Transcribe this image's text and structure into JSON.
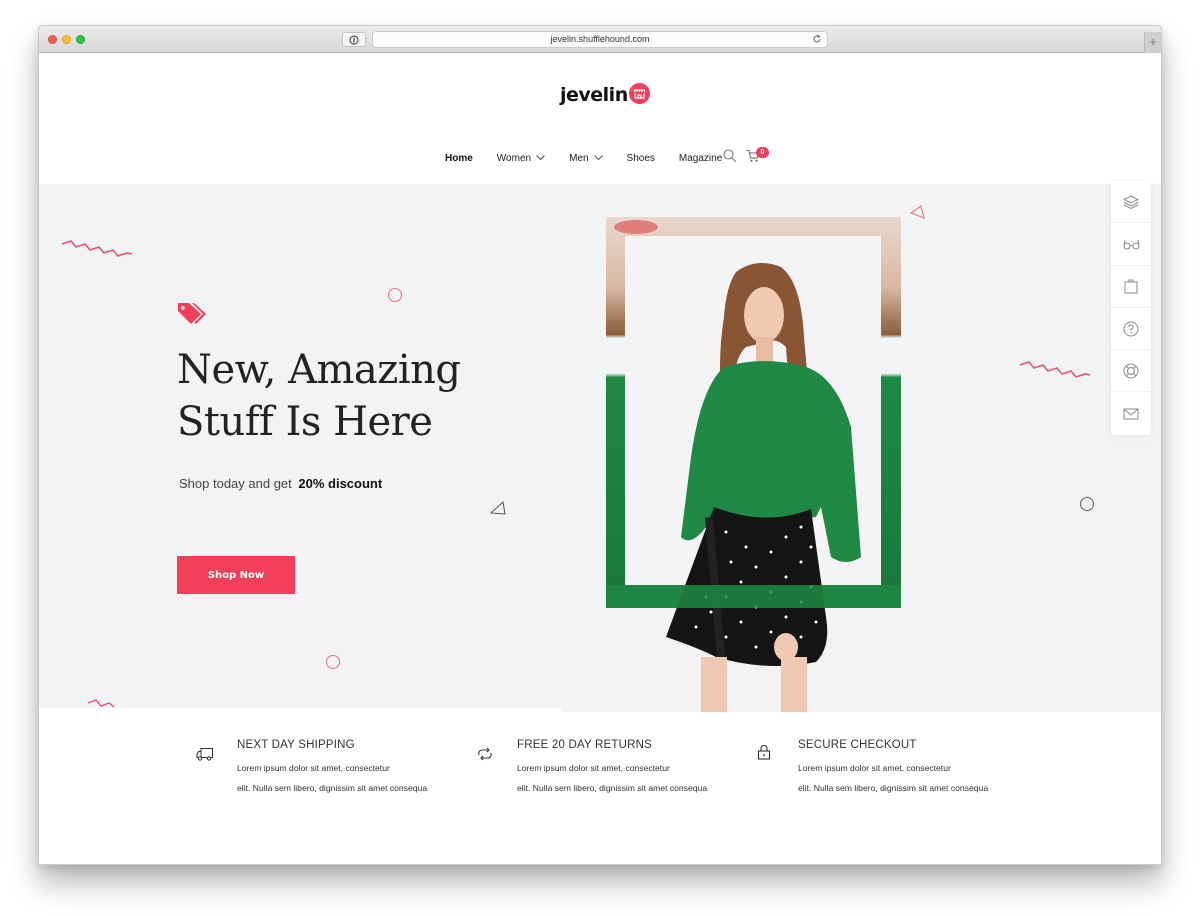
{
  "browser": {
    "url": "jevelin.shufflehound.com",
    "new_tab_label": "+"
  },
  "header": {
    "logo_text": "jevelin",
    "nav": [
      {
        "label": "Home",
        "active": true,
        "has_dropdown": false
      },
      {
        "label": "Women",
        "active": false,
        "has_dropdown": true
      },
      {
        "label": "Men",
        "active": false,
        "has_dropdown": true
      },
      {
        "label": "Shoes",
        "active": false,
        "has_dropdown": false
      },
      {
        "label": "Magazine",
        "active": false,
        "has_dropdown": false
      }
    ],
    "cart_count": "0",
    "icons": [
      "search-icon",
      "cart-icon"
    ]
  },
  "hero": {
    "title_line1": "New, Amazing",
    "title_line2": "Stuff Is Here",
    "subtitle_prefix": "Shop today and get",
    "subtitle_highlight": "20% discount",
    "cta_label": "Shop Now",
    "icon": "price-tag-icon"
  },
  "tool_rail": [
    "layers-icon",
    "glasses-icon",
    "shopping-bag-icon",
    "help-icon",
    "lifebuoy-icon",
    "mail-icon"
  ],
  "features": [
    {
      "icon": "truck-icon",
      "title": "NEXT DAY SHIPPING",
      "line1": "Lorem ipsum dolor sit amet, consectetur",
      "line2": "elit. Nulla sem libero, dignissim sit amet consequa"
    },
    {
      "icon": "refresh-icon",
      "title": "FREE 20 DAY RETURNS",
      "line1": "Lorem ipsum dolor sit amet, consectetur",
      "line2": "elit. Nulla sem libero, dignissim sit amet consequa"
    },
    {
      "icon": "lock-icon",
      "title": "SECURE CHECKOUT",
      "line1": "Lorem ipsum dolor sit amet, consectetur",
      "line2": "elit. Nulla sem libero, dignissim sit amet consequa"
    }
  ],
  "colors": {
    "accent": "#f43f5a",
    "hero_bg": "#f2f3f5",
    "text": "#222222"
  }
}
